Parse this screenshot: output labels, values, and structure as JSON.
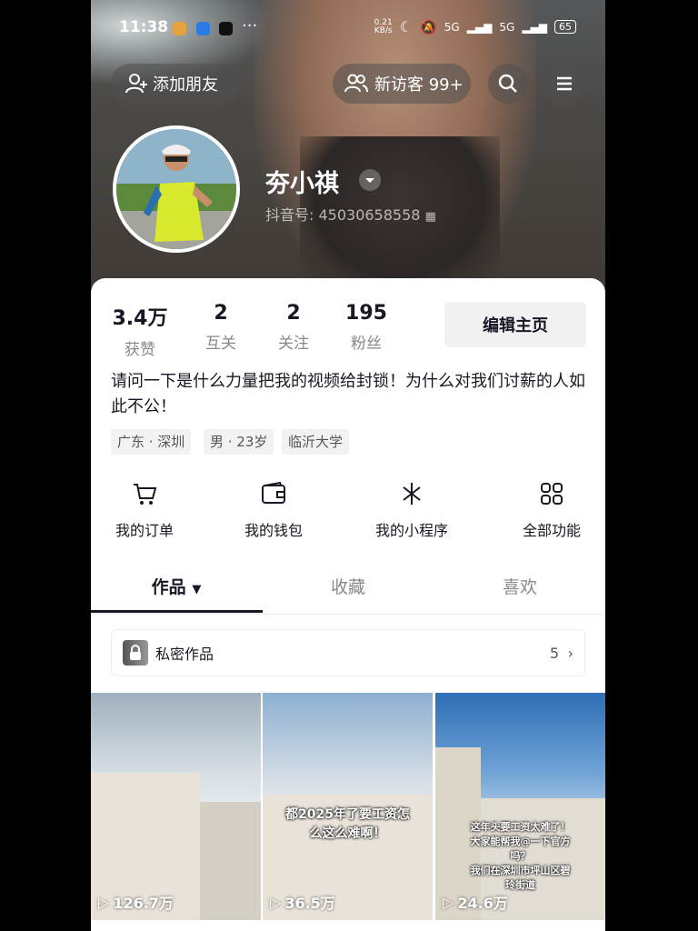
{
  "status_bar": {
    "time": "11:38",
    "net_speed": "0.21\nKB/s",
    "signal1": "5G",
    "signal2": "5G",
    "battery": "65"
  },
  "header": {
    "add_friend": "添加朋友",
    "visitors": "新访客 99+"
  },
  "profile": {
    "name": "夯小祺",
    "douyin_id": "抖音号: 45030658558"
  },
  "stats": [
    {
      "value": "3.4万",
      "label": "获赞"
    },
    {
      "value": "2",
      "label": "互关"
    },
    {
      "value": "2",
      "label": "关注"
    },
    {
      "value": "195",
      "label": "粉丝"
    }
  ],
  "edit_button": "编辑主页",
  "bio": "请问一下是什么力量把我的视频给封锁！为什么对我们讨薪的人如此不公！",
  "tags": [
    "广东 · 深圳",
    "男 · 23岁",
    "临沂大学"
  ],
  "functions": [
    {
      "label": "我的订单",
      "icon": "cart-icon"
    },
    {
      "label": "我的钱包",
      "icon": "wallet-icon"
    },
    {
      "label": "我的小程序",
      "icon": "mini-program-icon"
    },
    {
      "label": "全部功能",
      "icon": "grid-icon"
    }
  ],
  "tabs": [
    {
      "label": "作品",
      "active": true
    },
    {
      "label": "收藏",
      "active": false
    },
    {
      "label": "喜欢",
      "active": false
    }
  ],
  "private_works": {
    "label": "私密作品",
    "count": "5"
  },
  "videos": [
    {
      "views": "126.7万",
      "overlay": ""
    },
    {
      "views": "36.5万",
      "overlay": "都2025年了要工资怎\n么这么难啊！"
    },
    {
      "views": "24.6万",
      "overlay": "这年头要工资太难了！\n大家能帮我@一下官方\n吗？\n我们在深圳市坪山区碧\n玲街道"
    }
  ],
  "colors": {
    "text": "#161823",
    "muted": "#888888",
    "accent_dark": "#161823"
  }
}
